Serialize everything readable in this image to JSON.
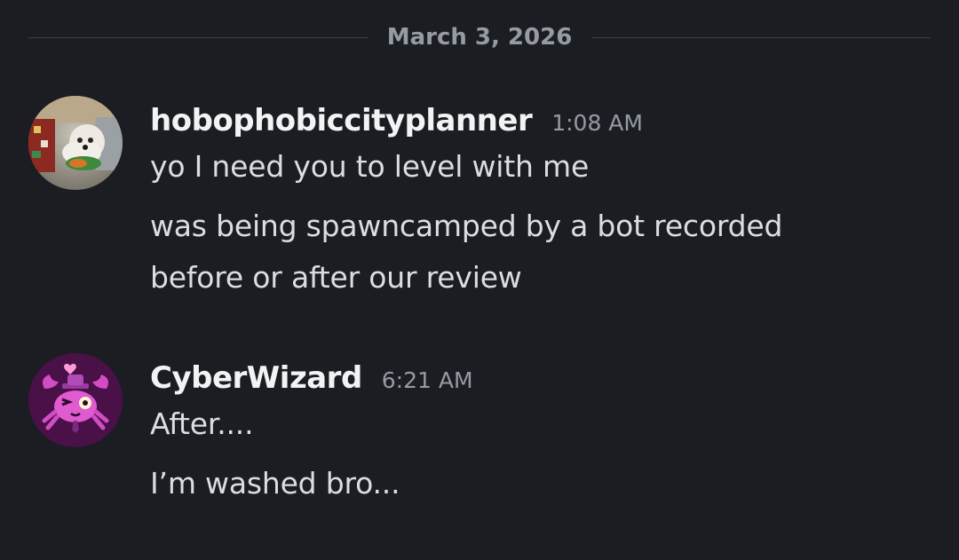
{
  "date_divider": {
    "label": "March 3, 2026"
  },
  "messages": [
    {
      "username": "hobophobiccityplanner",
      "timestamp": "1:08 AM",
      "avatar_icon": "dog-photo-avatar",
      "lines": [
        "yo I need you to level with me",
        "was being spawncamped by a bot recorded before or after our review"
      ]
    },
    {
      "username": "CyberWizard",
      "timestamp": "6:21 AM",
      "avatar_icon": "pink-crab-wizard-avatar",
      "lines": [
        "After....",
        "I’m washed bro..."
      ]
    }
  ],
  "colors": {
    "background": "#1c1d22",
    "username": "#f2f3f5",
    "message_text": "#dbdee1",
    "muted": "#949ba4",
    "divider_line": "#3f4147",
    "avatar2_bg": "#4a1048",
    "avatar2_accent": "#e05ad0"
  }
}
